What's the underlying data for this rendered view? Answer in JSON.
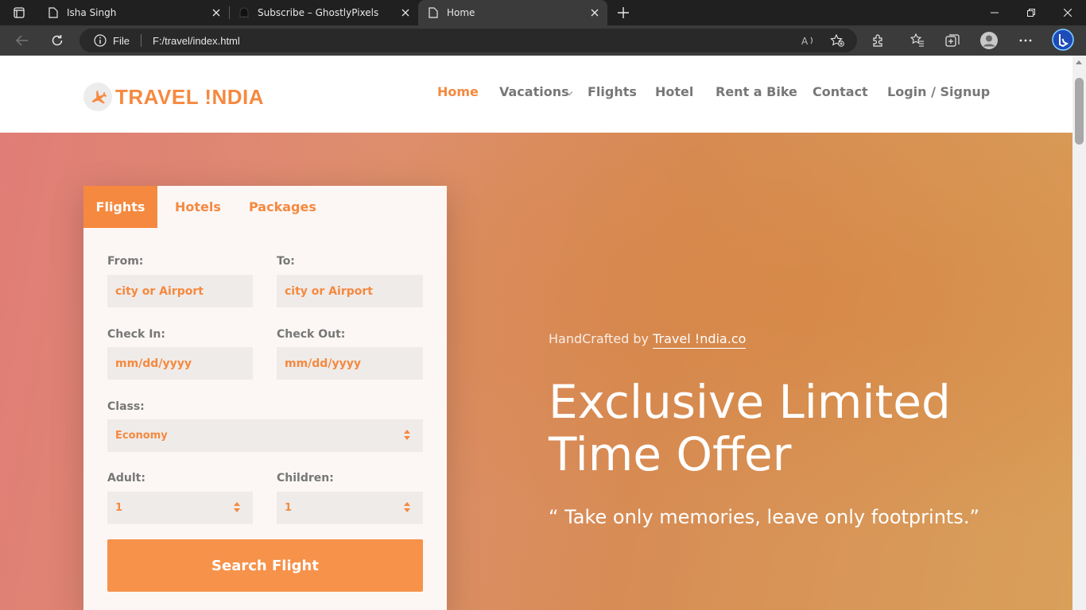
{
  "browser": {
    "tabs": [
      {
        "title": "Isha Singh"
      },
      {
        "title": "Subscribe – GhostlyPixels"
      },
      {
        "title": "Home"
      }
    ],
    "address": {
      "scheme": "File",
      "url": "F:/travel/index.html"
    }
  },
  "site": {
    "logo_text": "TRAVEL !NDIA",
    "nav": [
      "Home",
      "Vacations",
      "Flights",
      "Hotel",
      "Rent a Bike",
      "Contact",
      "Login / Signup"
    ]
  },
  "booking": {
    "tabs": [
      "Flights",
      "Hotels",
      "Packages"
    ],
    "from_label": "From:",
    "from_placeholder": "city or Airport",
    "to_label": "To:",
    "to_placeholder": "city or Airport",
    "checkin_label": "Check In:",
    "checkin_placeholder": "mm/dd/yyyy",
    "checkout_label": "Check Out:",
    "checkout_placeholder": "mm/dd/yyyy",
    "class_label": "Class:",
    "class_value": "Economy",
    "adult_label": "Adult:",
    "adult_value": "1",
    "children_label": "Children:",
    "children_value": "1",
    "search_label": "Search Flight"
  },
  "hero": {
    "credit_prefix": "HandCrafted by",
    "credit_link": "Travel !ndia.co",
    "headline": "Exclusive Limited Time Offer",
    "quote": "“ Take only memories, leave only footprints.”"
  },
  "colors": {
    "accent": "#f5893f",
    "chrome_bg": "#202020"
  }
}
